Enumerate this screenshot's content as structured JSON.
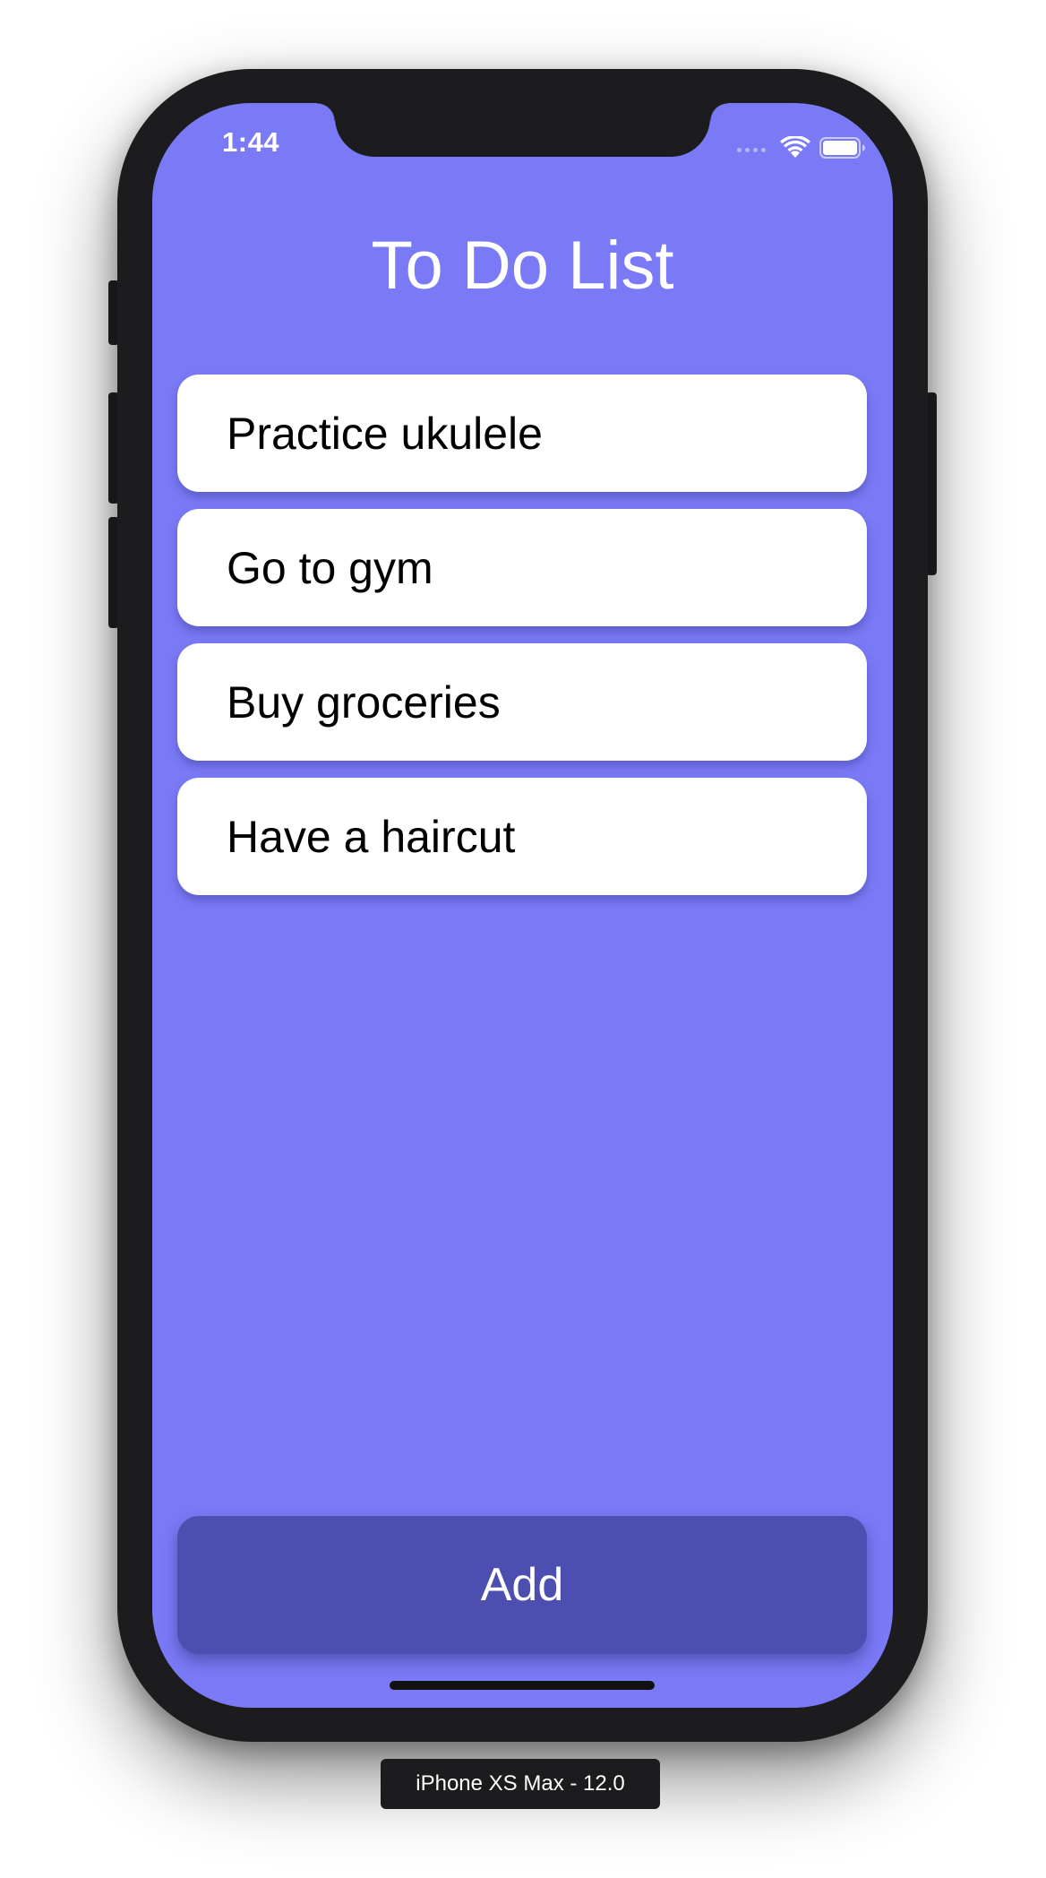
{
  "status_bar": {
    "time": "1:44",
    "icons": [
      "signal-dots-icon",
      "wifi-icon",
      "battery-icon"
    ]
  },
  "app": {
    "title": "To Do List",
    "todos": [
      {
        "label": "Practice ukulele"
      },
      {
        "label": "Go to gym"
      },
      {
        "label": "Buy groceries"
      },
      {
        "label": "Have a haircut"
      }
    ],
    "add_label": "Add"
  },
  "simulator": {
    "device_label": "iPhone XS Max - 12.0"
  },
  "colors": {
    "background": "#7a7af6",
    "card": "#ffffff",
    "add_button": "#4c4eb0",
    "device_frame": "#1c1c1e"
  }
}
